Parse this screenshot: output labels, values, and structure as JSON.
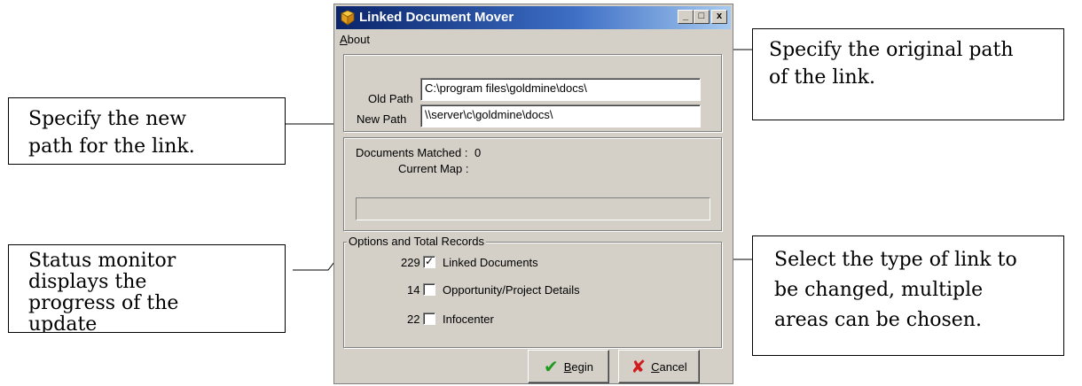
{
  "window": {
    "title": "Linked Document Mover",
    "menu_about_first": "A",
    "menu_about_rest": "bout",
    "minimize": "_",
    "maximize": "□",
    "close": "x"
  },
  "paths": {
    "old_label": "Old Path",
    "old_value": "C:\\program files\\goldmine\\docs\\",
    "new_label": "New Path",
    "new_value": "\\\\server\\c\\goldmine\\docs\\"
  },
  "status": {
    "matched_label": "Documents Matched :",
    "matched_value": "0",
    "current_map_label": "Current Map :"
  },
  "options": {
    "title": "Options and Total Records",
    "items": [
      {
        "count": "229",
        "checked": "✓",
        "label": "Linked Documents"
      },
      {
        "count": "14",
        "checked": "",
        "label": "Opportunity/Project Details"
      },
      {
        "count": "22",
        "checked": "",
        "label": "Infocenter"
      }
    ]
  },
  "buttons": {
    "begin_first": "B",
    "begin_rest": "egin",
    "begin_icon": "✔",
    "cancel_first": "C",
    "cancel_rest": "ancel",
    "cancel_icon": "✘"
  },
  "callouts": {
    "new_path": [
      "Specify the new",
      "path for the link."
    ],
    "original_path": [
      "Specify the original path",
      "of the link."
    ],
    "status": [
      "Status monitor",
      "displays the",
      "progress of the",
      "update"
    ],
    "link_type": [
      "Select the type of link to",
      "be changed, multiple",
      "areas can be chosen."
    ]
  },
  "colors": {
    "check_green": "#1f9a1f",
    "cancel_red": "#d01c1c"
  }
}
